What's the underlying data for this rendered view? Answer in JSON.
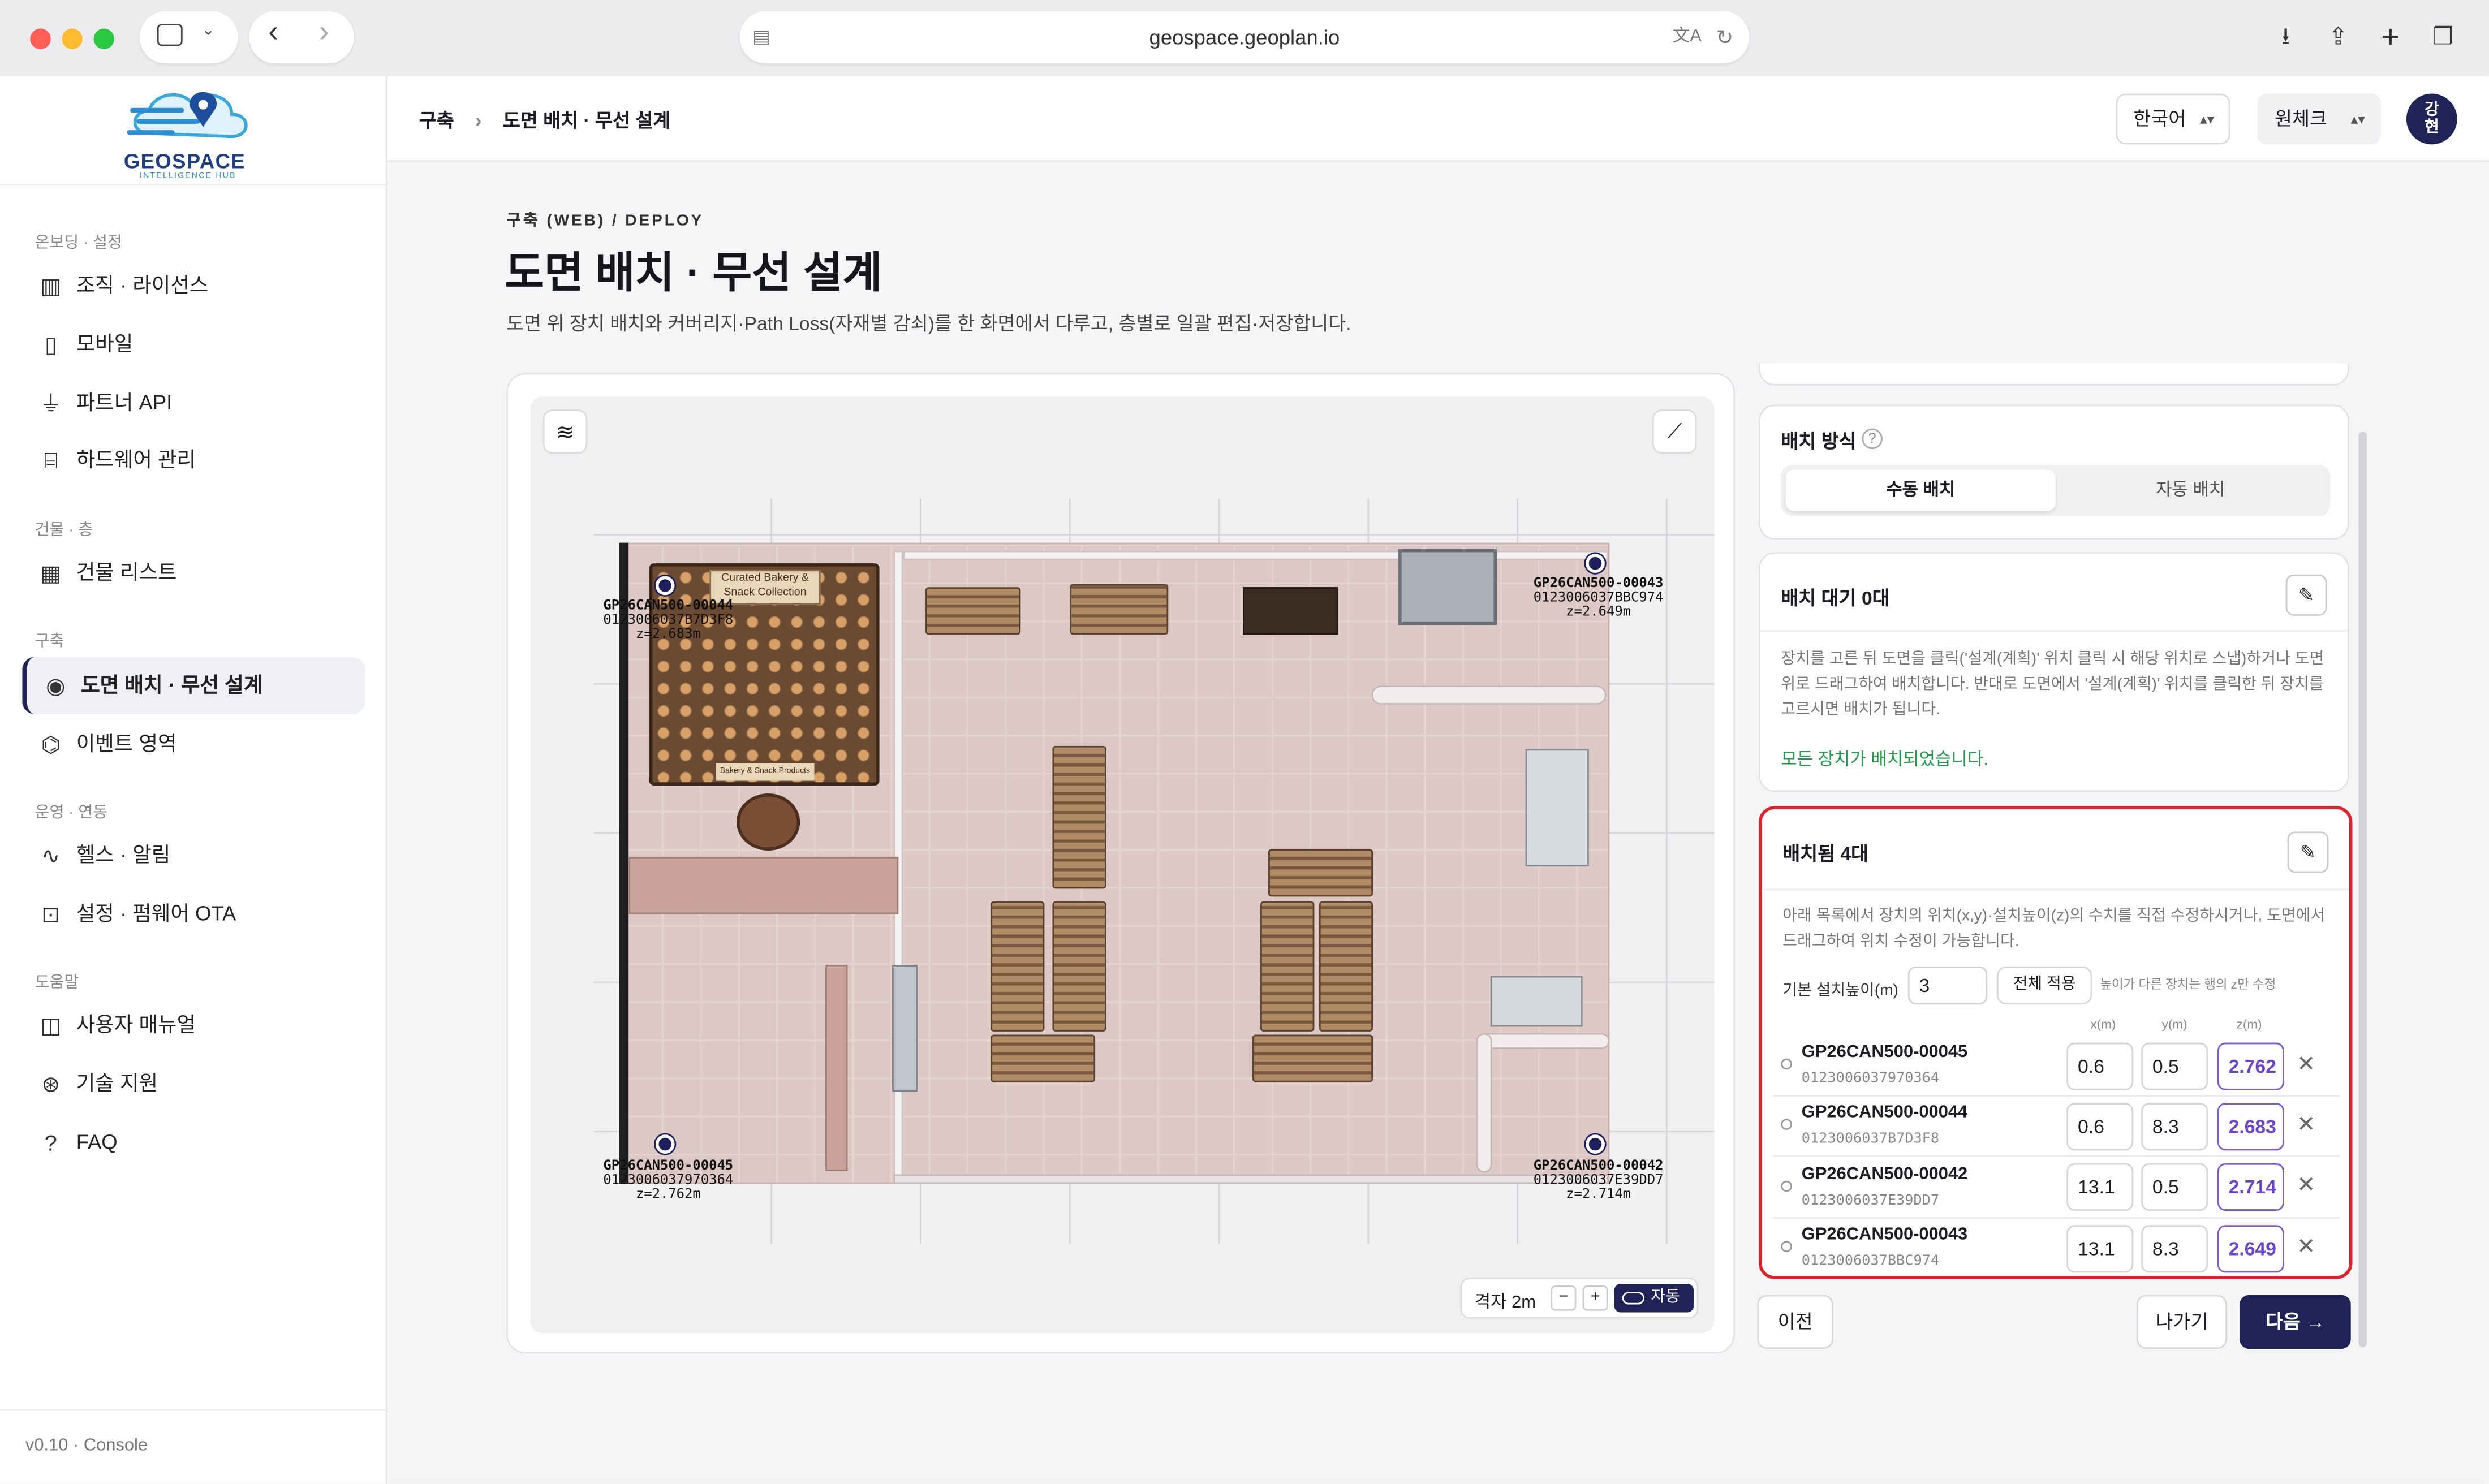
{
  "browser": {
    "url": "geospace.geoplan.io"
  },
  "logo": {
    "name": "GEOSPACE",
    "tagline": "INTELLIGENCE HUB"
  },
  "sidebar": {
    "sections": [
      {
        "title": "온보딩 · 설정",
        "items": [
          {
            "label": "조직 · 라이선스",
            "icon": "building-icon"
          },
          {
            "label": "모바일",
            "icon": "mobile-icon"
          },
          {
            "label": "파트너 API",
            "icon": "plug-icon"
          },
          {
            "label": "하드웨어 관리",
            "icon": "hardware-icon"
          }
        ]
      },
      {
        "title": "건물 · 층",
        "items": [
          {
            "label": "건물 리스트",
            "icon": "building-list-icon"
          }
        ]
      },
      {
        "title": "구축",
        "items": [
          {
            "label": "도면 배치 · 무선 설계",
            "icon": "location-pin-icon"
          },
          {
            "label": "이벤트 영역",
            "icon": "shapes-icon"
          }
        ]
      },
      {
        "title": "운영 · 연동",
        "items": [
          {
            "label": "헬스 · 알림",
            "icon": "pulse-icon"
          },
          {
            "label": "설정 · 펌웨어 OTA",
            "icon": "chip-icon"
          }
        ]
      },
      {
        "title": "도움말",
        "items": [
          {
            "label": "사용자 매뉴얼",
            "icon": "book-icon"
          },
          {
            "label": "기술 지원",
            "icon": "lifebuoy-icon"
          },
          {
            "label": "FAQ",
            "icon": "help-icon"
          }
        ]
      }
    ],
    "version": "v0.10 · Console"
  },
  "header": {
    "breadcrumb": [
      "구축",
      "도면 배치 · 무선 설계"
    ],
    "language": "한국어",
    "workspace": "원체크",
    "avatar": "강현"
  },
  "page": {
    "eyebrow": "구축 (WEB) / DEPLOY",
    "title": "도면 배치 · 무선 설계",
    "description": "도면 위 장치 배치와 커버리지·Path Loss(자재별 감쇠)를 한 화면에서 다루고, 층별로 일괄 편집·저장합니다."
  },
  "map": {
    "markers": [
      {
        "id": "GP26CAN500-00044",
        "serial": "0123006037B7D3F8",
        "z": "z=2.683m"
      },
      {
        "id": "GP26CAN500-00043",
        "serial": "0123006037BBC974",
        "z": "z=2.649m"
      },
      {
        "id": "GP26CAN500-00045",
        "serial": "0123006037970364",
        "z": "z=2.762m"
      },
      {
        "id": "GP26CAN500-00042",
        "serial": "0123006037E39DD7",
        "z": "z=2.714m"
      }
    ],
    "sign_text": "Curated Bakery & Snack Collection",
    "sign2": "Bakery & Snack Products",
    "grid_label": "격자 2m",
    "minus": "−",
    "plus": "+",
    "auto": "자동"
  },
  "placement_mode": {
    "title": "배치 방식",
    "help": "?",
    "tabs": [
      "수동 배치",
      "자동 배치"
    ]
  },
  "waiting": {
    "title": "배치 대기 0대",
    "desc": "장치를 고른 뒤 도면을 클릭('설계(계획)' 위치 클릭 시 해당 위치로 스냅)하거나 도면 위로 드래그하여 배치합니다. 반대로 도면에서 '설계(계획)' 위치를 클릭한 뒤 장치를 고르시면 배치가 됩니다.",
    "done": "모든 장치가 배치되었습니다."
  },
  "placed": {
    "title": "배치됨 4대",
    "desc": "아래 목록에서 장치의 위치(x,y)·설치높이(z)의 수치를 직접 수정하시거나, 도면에서 드래그하여 위치 수정이 가능합니다.",
    "default_height_label": "기본 설치높이(m)",
    "default_height": "3",
    "apply_all": "전체 적용",
    "hint": "높이가 다른 장치는 행의 z만 수정",
    "cols": [
      "x(m)",
      "y(m)",
      "z(m)"
    ],
    "rows": [
      {
        "id": "GP26CAN500-00045",
        "serial": "0123006037970364",
        "x": "0.6",
        "y": "0.5",
        "z": "2.762"
      },
      {
        "id": "GP26CAN500-00044",
        "serial": "0123006037B7D3F8",
        "x": "0.6",
        "y": "8.3",
        "z": "2.683"
      },
      {
        "id": "GP26CAN500-00042",
        "serial": "0123006037E39DD7",
        "x": "13.1",
        "y": "0.5",
        "z": "2.714"
      },
      {
        "id": "GP26CAN500-00043",
        "serial": "0123006037BBC974",
        "x": "13.1",
        "y": "8.3",
        "z": "2.649"
      }
    ]
  },
  "footer": {
    "prev": "이전",
    "exit": "나가기",
    "next": "다음 →"
  },
  "colors": {
    "navy": "#1f2358",
    "highlight": "#e0202a",
    "success": "#1f9d4c",
    "purple": "#6b45d0"
  }
}
